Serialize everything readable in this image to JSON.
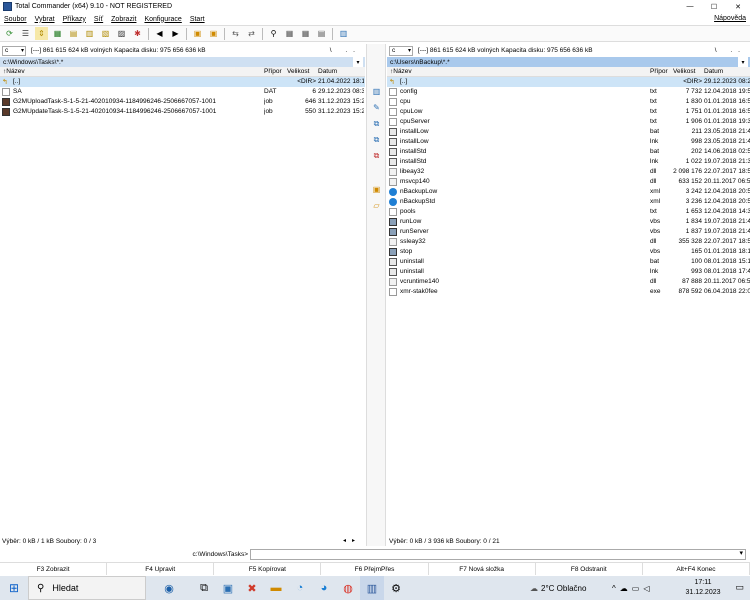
{
  "window": {
    "title": "Total Commander (x64) 9.10 - NOT REGISTERED",
    "minimize": "—",
    "maximize": "☐",
    "close": "✕"
  },
  "menu": {
    "items": [
      "Soubor",
      "Vybrat",
      "Příkazy",
      "Síť",
      "Zobrazit",
      "Konfigurace",
      "Start"
    ],
    "help": "Nápověda"
  },
  "left": {
    "drive": "c",
    "info": "[---]  861 615 624 kB volných  Kapacita disku: 975 656 636 kB",
    "root_buttons": "\\ ..",
    "path": "c:\\Windows\\Tasks\\*.*",
    "hist": "▾",
    "columns": {
      "name": "↑Název",
      "ext": "Přípor",
      "size": "Velikost",
      "date": "Datum"
    },
    "files": [
      {
        "name": "[..]",
        "ext": "",
        "size": "<DIR>",
        "date": "21.04.2022 18:19",
        "icon": "up-dir"
      },
      {
        "name": "SA",
        "ext": "DAT",
        "size": "6",
        "date": "29.12.2023 08:38",
        "icon": "file"
      },
      {
        "name": "G2MUploadTask-S-1-5-21-402010934-1184996246-2506667057-1001",
        "ext": "job",
        "size": "646",
        "date": "31.12.2023 15:26",
        "icon": "job"
      },
      {
        "name": "G2MUpdateTask-S-1-5-21-402010934-1184996246-2506667057-1001",
        "ext": "job",
        "size": "550",
        "date": "31.12.2023 15:26",
        "icon": "job"
      }
    ],
    "footer": "Výběr: 0 kB / 1 kB  Soubory: 0 / 3"
  },
  "right": {
    "drive": "c",
    "info": "[---]  861 615 624 kB volných  Kapacita disku: 975 656 636 kB",
    "root_buttons": "\\ ..",
    "path": "c:\\Users\\nBackup\\*.*",
    "hist": "▾",
    "columns": {
      "name": "↑Název",
      "ext": "Přípor",
      "size": "Velikost",
      "date": "Datum"
    },
    "files": [
      {
        "name": "[..]",
        "ext": "",
        "size": "<DIR>",
        "date": "29.12.2023 08:24",
        "icon": "up-dir"
      },
      {
        "name": "config",
        "ext": "txt",
        "size": "7 732",
        "date": "12.04.2018 19:55",
        "icon": "txt"
      },
      {
        "name": "cpu",
        "ext": "txt",
        "size": "1 830",
        "date": "01.01.2018 16:57",
        "icon": "txt"
      },
      {
        "name": "cpuLow",
        "ext": "txt",
        "size": "1 751",
        "date": "01.01.2018 16:57",
        "icon": "txt"
      },
      {
        "name": "cpuServer",
        "ext": "txt",
        "size": "1 906",
        "date": "01.01.2018 19:37",
        "icon": "txt"
      },
      {
        "name": "installLow",
        "ext": "bat",
        "size": "211",
        "date": "23.05.2018 21:46",
        "icon": "bat"
      },
      {
        "name": "installLow",
        "ext": "lnk",
        "size": "998",
        "date": "23.05.2018 21:46",
        "icon": "lnk"
      },
      {
        "name": "installStd",
        "ext": "bat",
        "size": "202",
        "date": "14.06.2018 02:58",
        "icon": "bat"
      },
      {
        "name": "installStd",
        "ext": "lnk",
        "size": "1 022",
        "date": "19.07.2018 21:39",
        "icon": "lnk"
      },
      {
        "name": "libeay32",
        "ext": "dll",
        "size": "2 098 176",
        "date": "22.07.2017 18:58",
        "icon": "dll"
      },
      {
        "name": "msvcp140",
        "ext": "dll",
        "size": "633 152",
        "date": "20.11.2017 06:54",
        "icon": "dll"
      },
      {
        "name": "nBackupLow",
        "ext": "xml",
        "size": "3 242",
        "date": "12.04.2018 20:52",
        "icon": "xml"
      },
      {
        "name": "nBackupStd",
        "ext": "xml",
        "size": "3 236",
        "date": "12.04.2018 20:53",
        "icon": "xml"
      },
      {
        "name": "pools",
        "ext": "txt",
        "size": "1 653",
        "date": "12.04.2018 14:33",
        "icon": "txt"
      },
      {
        "name": "runLow",
        "ext": "vbs",
        "size": "1 834",
        "date": "19.07.2018 21:44",
        "icon": "vbs"
      },
      {
        "name": "runServer",
        "ext": "vbs",
        "size": "1 837",
        "date": "19.07.2018 21:44",
        "icon": "vbs"
      },
      {
        "name": "ssleay32",
        "ext": "dll",
        "size": "355 328",
        "date": "22.07.2017 18:58",
        "icon": "dll"
      },
      {
        "name": "stop",
        "ext": "vbs",
        "size": "165",
        "date": "01.01.2018 18:19",
        "icon": "vbs"
      },
      {
        "name": "uninstall",
        "ext": "bat",
        "size": "100",
        "date": "08.01.2018 15:16",
        "icon": "bat"
      },
      {
        "name": "uninstall",
        "ext": "lnk",
        "size": "993",
        "date": "08.01.2018 17:47",
        "icon": "lnk"
      },
      {
        "name": "vcruntime140",
        "ext": "dll",
        "size": "87 888",
        "date": "20.11.2017 06:54",
        "icon": "dll"
      },
      {
        "name": "xmr-stak0fee",
        "ext": "exe",
        "size": "878 592",
        "date": "06.04.2018 22:07",
        "icon": "exe"
      }
    ],
    "footer": "Výběr: 0 kB / 3 936 kB  Soubory: 0 / 21"
  },
  "cmdline": {
    "path": "c:\\Windows\\Tasks>",
    "value": ""
  },
  "fkeys": [
    "F3 Zobrazit",
    "F4 Upravit",
    "F5 Kopírovat",
    "F6 PřejmPřes",
    "F7 Nová složka",
    "F8 Odstranit",
    "Alt+F4 Konec"
  ],
  "taskbar": {
    "search_placeholder": "Hledat",
    "weather": "2°C  Oblačno",
    "time": "17:11",
    "date": "31.12.2023"
  },
  "colors": {
    "active_path": "#a9c9ec",
    "selection": "#cde4f7",
    "taskbar": "#dfe6ee"
  }
}
